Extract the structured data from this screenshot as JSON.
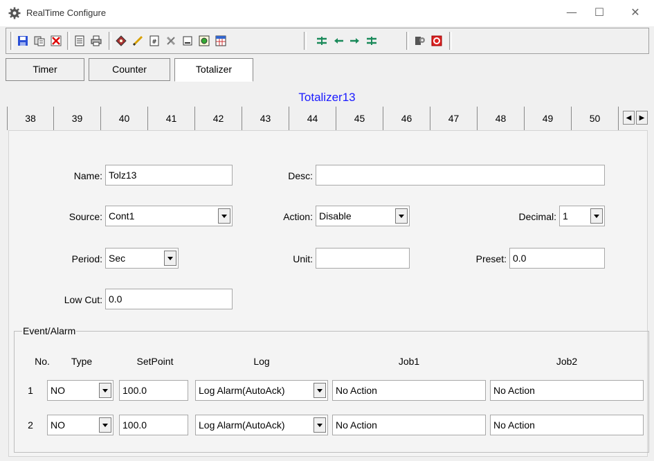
{
  "window": {
    "title": "RealTime Configure",
    "minimize": "—",
    "maximize": "☐",
    "close": "✕"
  },
  "toolbar": {
    "icons": [
      "save-icon",
      "save-as-icon",
      "delete-icon",
      "notes-icon",
      "print-icon",
      "tag-icon",
      "edit-icon",
      "calc-icon",
      "tools-icon",
      "page-icon",
      "chart-icon",
      "grid-icon",
      "first-icon",
      "prev-icon",
      "next-icon",
      "last-icon",
      "config-icon",
      "power-icon"
    ]
  },
  "main_tabs": [
    {
      "label": "Timer"
    },
    {
      "label": "Counter"
    },
    {
      "label": "Totalizer"
    }
  ],
  "panel_title": "Totalizer13",
  "number_tabs": [
    "38",
    "39",
    "40",
    "41",
    "42",
    "43",
    "44",
    "45",
    "46",
    "47",
    "48",
    "49",
    "50"
  ],
  "form": {
    "name_label": "Name:",
    "name_value": "Tolz13",
    "desc_label": "Desc:",
    "desc_value": "",
    "source_label": "Source:",
    "source_value": "Cont1",
    "action_label": "Action:",
    "action_value": "Disable",
    "decimal_label": "Decimal:",
    "decimal_value": "1",
    "period_label": "Period:",
    "period_value": "Sec",
    "unit_label": "Unit:",
    "unit_value": "",
    "preset_label": "Preset:",
    "preset_value": "0.0",
    "lowcut_label": "Low Cut:",
    "lowcut_value": "0.0"
  },
  "event_alarm": {
    "group_title": "Event/Alarm",
    "headers": {
      "no": "No.",
      "type": "Type",
      "setpoint": "SetPoint",
      "log": "Log",
      "job1": "Job1",
      "job2": "Job2"
    },
    "rows": [
      {
        "no": "1",
        "type": "NO",
        "setpoint": "100.0",
        "log": "Log Alarm(AutoAck)",
        "job1": "No Action",
        "job2": "No Action"
      },
      {
        "no": "2",
        "type": "NO",
        "setpoint": "100.0",
        "log": "Log Alarm(AutoAck)",
        "job1": "No Action",
        "job2": "No Action"
      }
    ]
  }
}
